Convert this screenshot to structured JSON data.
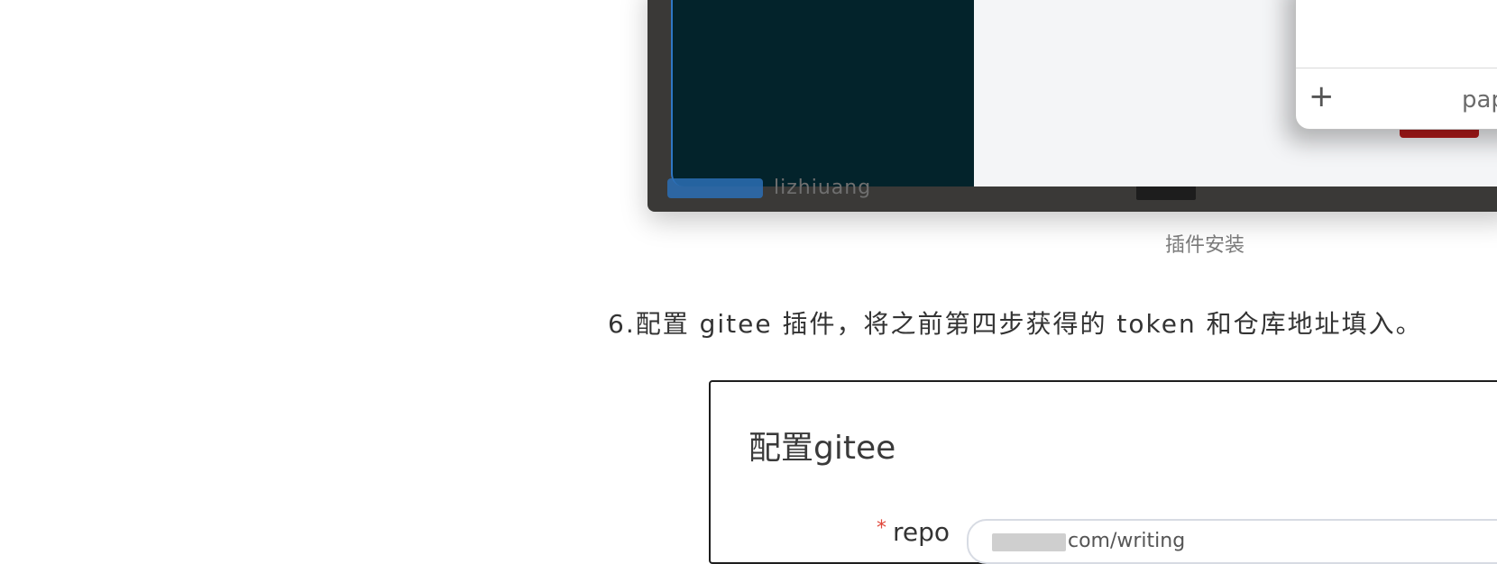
{
  "figure1": {
    "caption": "插件安装",
    "partial_name": "lizhiuang",
    "popup_suffix": "pap",
    "plus_icon": "+",
    "colors": {
      "dark_panel": "#03232b",
      "frame": "#3a3937",
      "light_panel": "#f4f5f7"
    }
  },
  "step": {
    "text": "6.配置 gitee 插件，将之前第四步获得的 token 和仓库地址填入。"
  },
  "figure2": {
    "dialog_title": "配置gitee",
    "required_mark": "*",
    "repo_label": "repo",
    "repo_value_partial": "com/writing"
  }
}
